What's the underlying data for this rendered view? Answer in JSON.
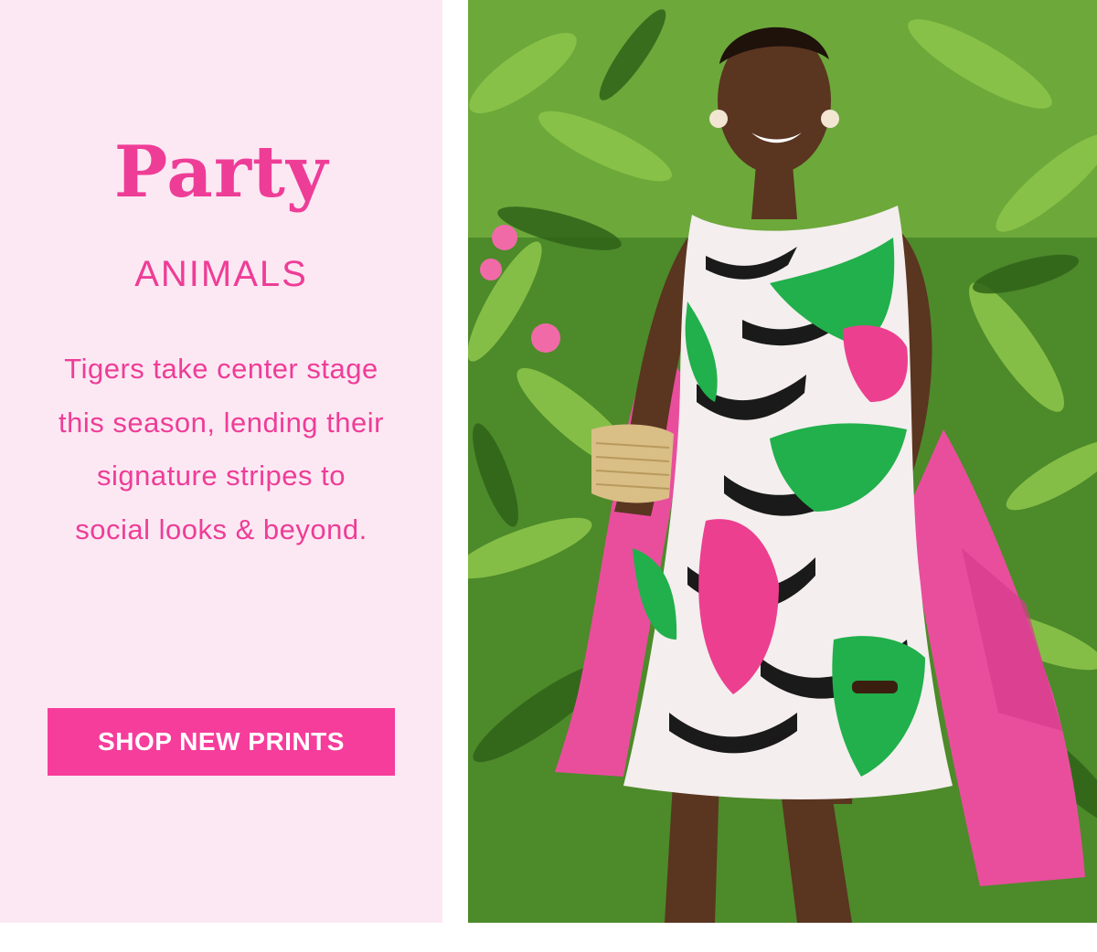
{
  "promo": {
    "title": "Party",
    "subtitle": "ANIMALS",
    "description": "Tigers take center stage this season, lending their signature stripes to social looks & beyond.",
    "cta_label": "SHOP NEW PRINTS"
  },
  "colors": {
    "brand_pink": "#ee3d97",
    "panel_background": "#fce8f3",
    "button_background": "#f63d9b",
    "button_text": "#ffffff"
  },
  "photo": {
    "icon": "fashion-model-photo"
  }
}
